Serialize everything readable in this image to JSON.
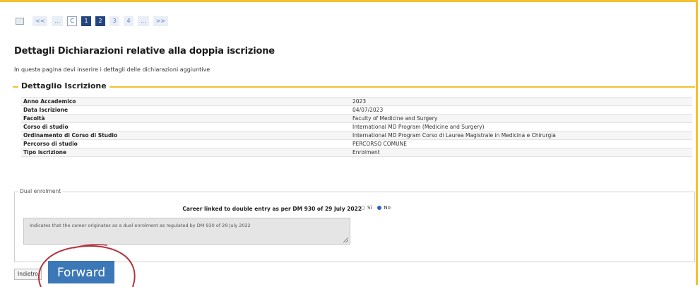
{
  "pager": {
    "items": [
      {
        "label": "<<",
        "style": "plain"
      },
      {
        "label": "...",
        "style": "plain"
      },
      {
        "label": "C",
        "style": "outline"
      },
      {
        "label": "1",
        "style": "active"
      },
      {
        "label": "2",
        "style": "active"
      },
      {
        "label": "3",
        "style": "plain"
      },
      {
        "label": "4",
        "style": "plain"
      },
      {
        "label": "...",
        "style": "plain"
      },
      {
        "label": ">>",
        "style": "plain"
      }
    ]
  },
  "page": {
    "title": "Dettagli Dichiarazioni relative alla doppia iscrizione",
    "intro": "In questa pagina devi inserire i dettagli delle dichiarazioni aggiuntive"
  },
  "details": {
    "legend": "Dettaglio Iscrizione",
    "rows": [
      {
        "label": "Anno Accademico",
        "value": "2023"
      },
      {
        "label": "Data Iscrizione",
        "value": "04/07/2023"
      },
      {
        "label": "Facoltà",
        "value": "Faculty of Medicine and Surgery"
      },
      {
        "label": "Corso di studio",
        "value": "International MD Program (Medicine and Surgery)"
      },
      {
        "label": "Ordinamento di Corso di Studio",
        "value": "International MD Program Corso di Laurea Magistrale in Medicina e Chirurgia"
      },
      {
        "label": "Percorso di studio",
        "value": "PERCORSO COMUNE"
      },
      {
        "label": "Tipo iscrizione",
        "value": "Enrolment"
      }
    ]
  },
  "dual": {
    "legend": "Dual enrolment",
    "question": "Career linked to double entry as per DM 930 of 29 July 2022*",
    "option_yes": "Sì",
    "option_no": "No",
    "selected": "No",
    "note": "Indicates that the career originates as a dual enrolment as regulated by DM 930 of 29 July 2022"
  },
  "buttons": {
    "back": "Indietro",
    "forward": "Forward"
  },
  "colors": {
    "accent": "#f2c12e",
    "forward_button": "#3c78b7",
    "annotation_circle": "#b5333f"
  }
}
